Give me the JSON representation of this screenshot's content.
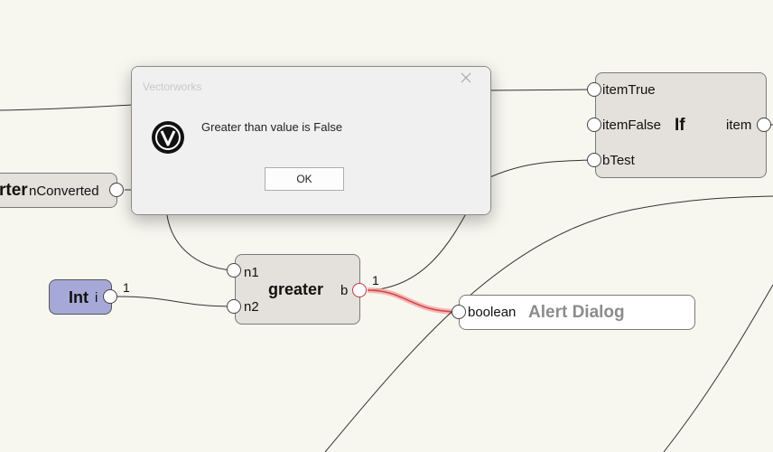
{
  "canvas": {
    "background": "#f7f6ef"
  },
  "nodes": {
    "converter": {
      "title_fragment": "rter",
      "output_label": "nConverted"
    },
    "int_node": {
      "title": "Int",
      "output_label": "i",
      "color": "#a6a8d8"
    },
    "greater": {
      "title": "greater",
      "input1_label": "n1",
      "input2_label": "n2",
      "output_label": "b"
    },
    "if_node": {
      "title": "If",
      "input1_label": "itemTrue",
      "input2_label": "itemFalse",
      "input3_label": "bTest",
      "output_label": "item"
    },
    "alert": {
      "input_label": "boolean",
      "title": "Alert Dialog"
    }
  },
  "edge_labels": {
    "int_out": "1",
    "greater_out": "1"
  },
  "dialog": {
    "title": "Vectorworks",
    "message": "Greater than value is False",
    "ok_label": "OK",
    "icon": "vectorworks-logo-icon",
    "close_icon": "close-icon"
  },
  "colors": {
    "node_fill": "#e4e0dc",
    "highlight_wire": "#e06060"
  }
}
